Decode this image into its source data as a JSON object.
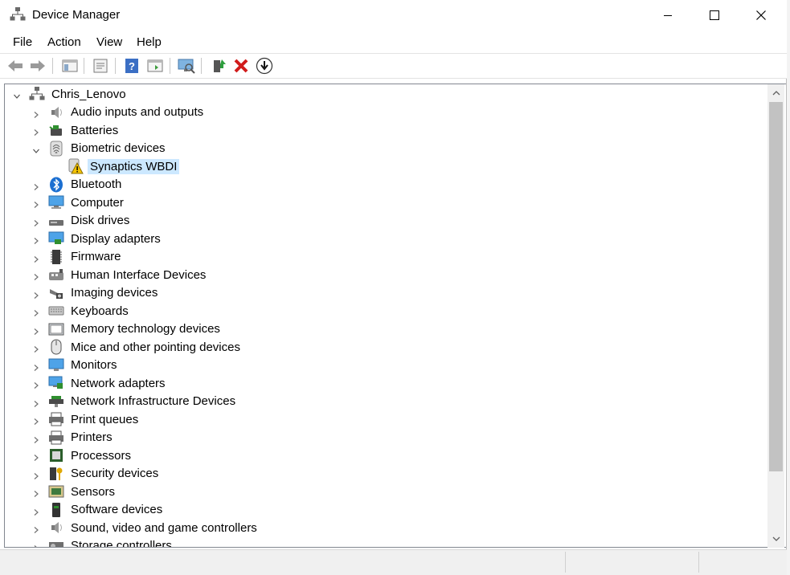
{
  "window": {
    "title": "Device Manager"
  },
  "menu": [
    "File",
    "Action",
    "View",
    "Help"
  ],
  "toolbar_icons": [
    "back-arrow-icon",
    "forward-arrow-icon",
    "show-hide-console-tree-icon",
    "properties-icon",
    "help-icon",
    "action-pane-icon",
    "scan-hardware-icon",
    "update-driver-icon",
    "uninstall-device-icon",
    "download-driver-icon"
  ],
  "tree": {
    "root": "Chris_Lenovo",
    "categories": [
      {
        "label": "Audio inputs and outputs",
        "icon": "speaker-icon",
        "expanded": false
      },
      {
        "label": "Batteries",
        "icon": "battery-icon",
        "expanded": false
      },
      {
        "label": "Biometric devices",
        "icon": "fingerprint-icon",
        "expanded": true,
        "children": [
          {
            "label": "Synaptics WBDI",
            "icon": "warning-device-icon",
            "selected": true
          }
        ]
      },
      {
        "label": "Bluetooth",
        "icon": "bluetooth-icon",
        "expanded": false
      },
      {
        "label": "Computer",
        "icon": "computer-icon",
        "expanded": false
      },
      {
        "label": "Disk drives",
        "icon": "disk-drive-icon",
        "expanded": false
      },
      {
        "label": "Display adapters",
        "icon": "display-adapter-icon",
        "expanded": false
      },
      {
        "label": "Firmware",
        "icon": "firmware-chip-icon",
        "expanded": false
      },
      {
        "label": "Human Interface Devices",
        "icon": "hid-icon",
        "expanded": false
      },
      {
        "label": "Imaging devices",
        "icon": "camera-icon",
        "expanded": false
      },
      {
        "label": "Keyboards",
        "icon": "keyboard-icon",
        "expanded": false
      },
      {
        "label": "Memory technology devices",
        "icon": "memory-card-icon",
        "expanded": false
      },
      {
        "label": "Mice and other pointing devices",
        "icon": "mouse-icon",
        "expanded": false
      },
      {
        "label": "Monitors",
        "icon": "monitor-icon",
        "expanded": false
      },
      {
        "label": "Network adapters",
        "icon": "network-adapter-icon",
        "expanded": false
      },
      {
        "label": "Network Infrastructure Devices",
        "icon": "network-infra-icon",
        "expanded": false
      },
      {
        "label": "Print queues",
        "icon": "print-queue-icon",
        "expanded": false
      },
      {
        "label": "Printers",
        "icon": "printer-icon",
        "expanded": false
      },
      {
        "label": "Processors",
        "icon": "processor-icon",
        "expanded": false
      },
      {
        "label": "Security devices",
        "icon": "security-key-icon",
        "expanded": false
      },
      {
        "label": "Sensors",
        "icon": "sensor-icon",
        "expanded": false
      },
      {
        "label": "Software devices",
        "icon": "software-device-icon",
        "expanded": false
      },
      {
        "label": "Sound, video and game controllers",
        "icon": "speaker-icon",
        "expanded": false
      },
      {
        "label": "Storage controllers",
        "icon": "storage-controller-icon",
        "expanded": false
      }
    ]
  }
}
